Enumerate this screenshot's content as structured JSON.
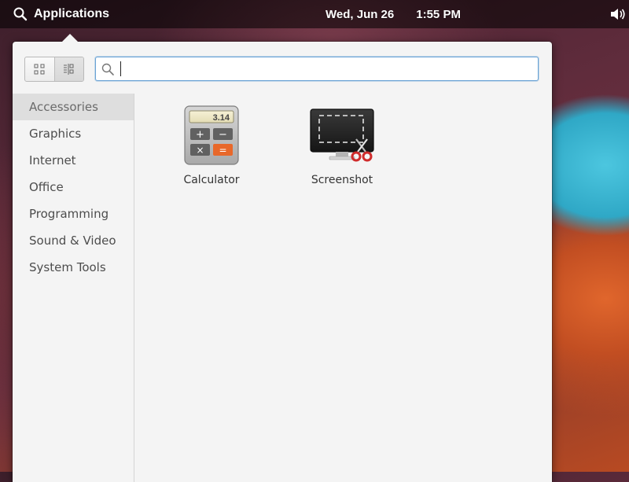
{
  "panel": {
    "applications_label": "Applications",
    "date": "Wed, Jun 26",
    "time": "1:55 PM"
  },
  "launcher": {
    "search": {
      "value": "",
      "placeholder": ""
    },
    "view_modes": [
      "grid-view",
      "category-view"
    ],
    "categories": [
      {
        "label": "Accessories",
        "active": true
      },
      {
        "label": "Graphics"
      },
      {
        "label": "Internet"
      },
      {
        "label": "Office"
      },
      {
        "label": "Programming"
      },
      {
        "label": "Sound & Video"
      },
      {
        "label": "System Tools"
      }
    ],
    "apps": [
      {
        "label": "Calculator",
        "icon": "calculator-icon",
        "display": "3.14"
      },
      {
        "label": "Screenshot",
        "icon": "screenshot-icon"
      }
    ]
  },
  "colors": {
    "accent": "#6aa3d5",
    "panel_bg": "#000000",
    "calc_equals": "#e8682a"
  }
}
